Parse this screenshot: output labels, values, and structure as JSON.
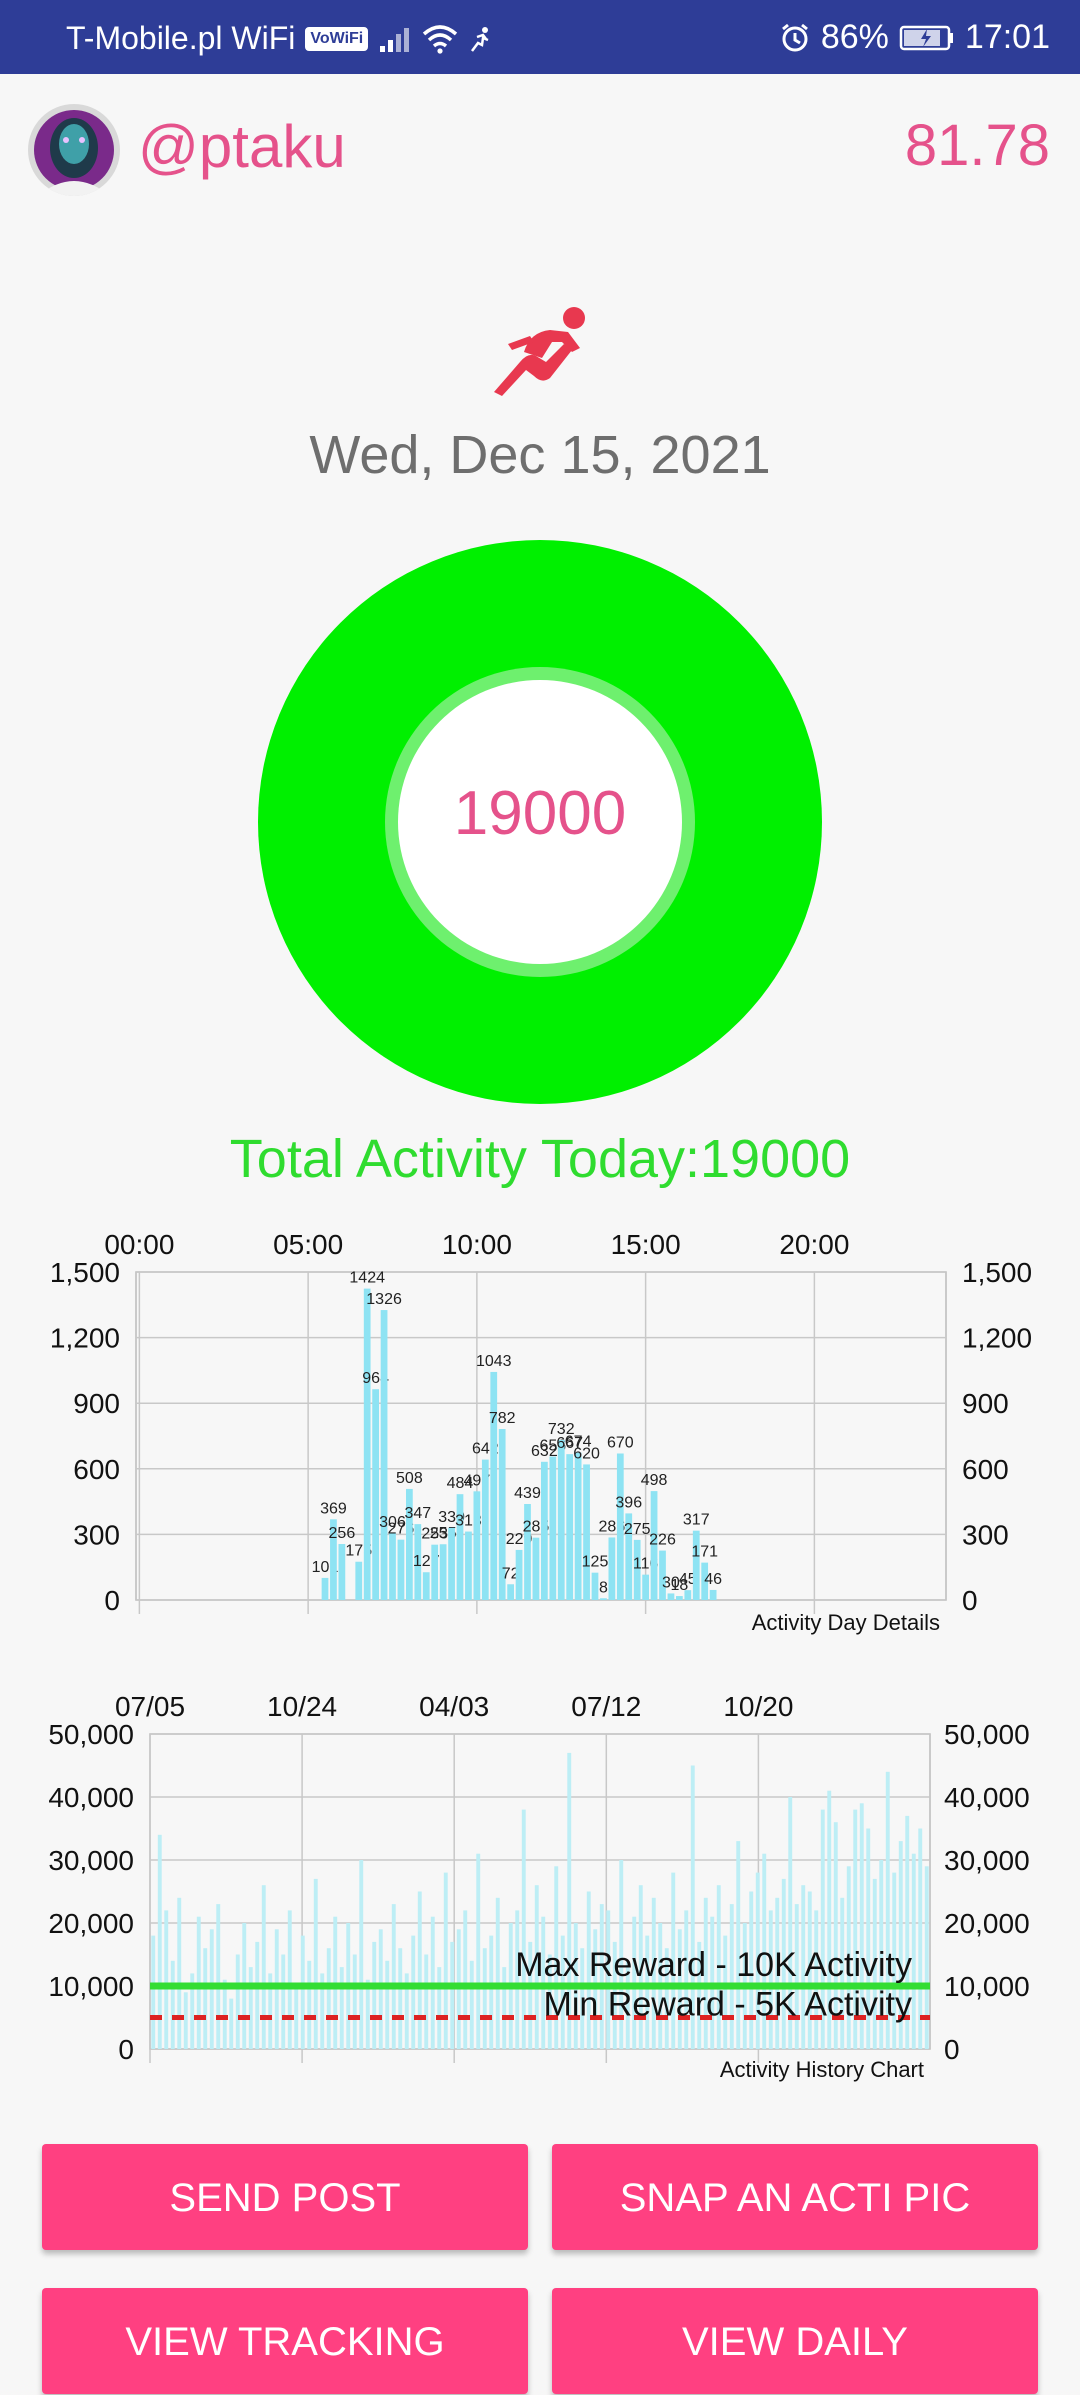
{
  "status_bar": {
    "carrier": "T-Mobile.pl WiFi",
    "vowifi": "VoWiFi",
    "battery": "86%",
    "time": "17:01"
  },
  "header": {
    "username": "@ptaku",
    "score": "81.78"
  },
  "date": "Wed, Dec 15, 2021",
  "ring": {
    "value": "19000",
    "progress": 1.0,
    "color": "#00f000"
  },
  "total_activity": "Total Activity Today:19000",
  "chart_data": [
    {
      "type": "bar",
      "name": "Activity Day Details",
      "x_tick_labels": [
        "00:00",
        "05:00",
        "10:00",
        "15:00",
        "20:00"
      ],
      "x_tick_hours": [
        0,
        5,
        10,
        15,
        20
      ],
      "xlim": [
        -0.1,
        23.9
      ],
      "ylim": [
        0,
        1500
      ],
      "y_ticks": [
        0,
        300,
        600,
        900,
        1200,
        1500
      ],
      "y_tick_labels": [
        "0",
        "300",
        "600",
        "900",
        "1,200",
        "1,500"
      ],
      "bar_color": "#8ee3f3",
      "grid": true,
      "data_labels": true,
      "bars": [
        {
          "hour": 5.5,
          "value": 101
        },
        {
          "hour": 5.75,
          "value": 369
        },
        {
          "hour": 6.0,
          "value": 256
        },
        {
          "hour": 6.25,
          "value": 0
        },
        {
          "hour": 6.5,
          "value": 175
        },
        {
          "hour": 6.75,
          "value": 1424
        },
        {
          "hour": 7.0,
          "value": 964
        },
        {
          "hour": 7.25,
          "value": 1326
        },
        {
          "hour": 7.5,
          "value": 306
        },
        {
          "hour": 7.75,
          "value": 276
        },
        {
          "hour": 8.0,
          "value": 508
        },
        {
          "hour": 8.25,
          "value": 347
        },
        {
          "hour": 8.5,
          "value": 127
        },
        {
          "hour": 8.75,
          "value": 253
        },
        {
          "hour": 9.0,
          "value": 255
        },
        {
          "hour": 9.25,
          "value": 330
        },
        {
          "hour": 9.5,
          "value": 484
        },
        {
          "hour": 9.75,
          "value": 313
        },
        {
          "hour": 10.0,
          "value": 497
        },
        {
          "hour": 10.25,
          "value": 642
        },
        {
          "hour": 10.5,
          "value": 1043
        },
        {
          "hour": 10.75,
          "value": 782
        },
        {
          "hour": 11.0,
          "value": 72
        },
        {
          "hour": 11.25,
          "value": 229
        },
        {
          "hour": 11.5,
          "value": 439
        },
        {
          "hour": 11.75,
          "value": 285
        },
        {
          "hour": 12.0,
          "value": 632
        },
        {
          "hour": 12.25,
          "value": 656
        },
        {
          "hour": 12.5,
          "value": 732
        },
        {
          "hour": 12.75,
          "value": 667
        },
        {
          "hour": 13.0,
          "value": 674
        },
        {
          "hour": 13.25,
          "value": 620
        },
        {
          "hour": 13.5,
          "value": 125
        },
        {
          "hour": 13.75,
          "value": 8
        },
        {
          "hour": 14.0,
          "value": 286
        },
        {
          "hour": 14.25,
          "value": 670
        },
        {
          "hour": 14.5,
          "value": 396
        },
        {
          "hour": 14.75,
          "value": 275
        },
        {
          "hour": 15.0,
          "value": 116
        },
        {
          "hour": 15.25,
          "value": 498
        },
        {
          "hour": 15.5,
          "value": 226
        },
        {
          "hour": 15.75,
          "value": 30
        },
        {
          "hour": 16.0,
          "value": 18
        },
        {
          "hour": 16.25,
          "value": 45
        },
        {
          "hour": 16.5,
          "value": 317
        },
        {
          "hour": 16.75,
          "value": 171
        },
        {
          "hour": 17.0,
          "value": 46
        }
      ]
    },
    {
      "type": "bar",
      "name": "Activity History Chart",
      "x_tick_labels": [
        "07/05",
        "10/24",
        "04/03",
        "07/12",
        "10/20"
      ],
      "y_ticks": [
        0,
        10000,
        20000,
        30000,
        40000,
        50000
      ],
      "y_tick_labels": [
        "0",
        "10,000",
        "20,000",
        "30,000",
        "40,000",
        "50,000"
      ],
      "ylim": [
        0,
        50000
      ],
      "bar_color": "#bdeef5",
      "grid": true,
      "reference_lines": [
        {
          "label": "Max Reward - 10K Activity",
          "value": 10000,
          "color": "#33dd33",
          "style": "solid"
        },
        {
          "label": "Min Reward - 5K Activity",
          "value": 5000,
          "color": "#dd2222",
          "style": "dashed"
        }
      ],
      "values": [
        18000,
        34000,
        22000,
        14000,
        24000,
        9000,
        12000,
        21000,
        16000,
        19000,
        23000,
        11000,
        8000,
        15000,
        20000,
        13000,
        17000,
        26000,
        12000,
        19000,
        15000,
        22000,
        10000,
        18000,
        14000,
        27000,
        12000,
        16000,
        21000,
        13000,
        20000,
        15000,
        30000,
        11000,
        17000,
        19000,
        14000,
        23000,
        16000,
        12000,
        18000,
        25000,
        15000,
        21000,
        13000,
        28000,
        17000,
        19000,
        22000,
        14000,
        31000,
        16000,
        18000,
        24000,
        13000,
        20000,
        22000,
        38000,
        17000,
        26000,
        21000,
        15000,
        29000,
        18000,
        47000,
        20000,
        16000,
        25000,
        19000,
        23000,
        22000,
        17000,
        30000,
        14000,
        21000,
        26000,
        18000,
        24000,
        20000,
        16000,
        28000,
        19000,
        22000,
        45000,
        17000,
        24000,
        21000,
        26000,
        18000,
        23000,
        33000,
        20000,
        25000,
        28000,
        31000,
        22000,
        24000,
        27000,
        40000,
        23000,
        26000,
        25000,
        22000,
        38000,
        41000,
        36000,
        24000,
        29000,
        38000,
        39000,
        35000,
        27000,
        30000,
        44000,
        28000,
        33000,
        37000,
        31000,
        35000,
        29000
      ]
    }
  ],
  "buttons": {
    "send_post": "SEND POST",
    "snap_pic": "SNAP AN ACTI PIC",
    "view_tracking": "VIEW TRACKING",
    "view_daily": "VIEW DAILY"
  }
}
